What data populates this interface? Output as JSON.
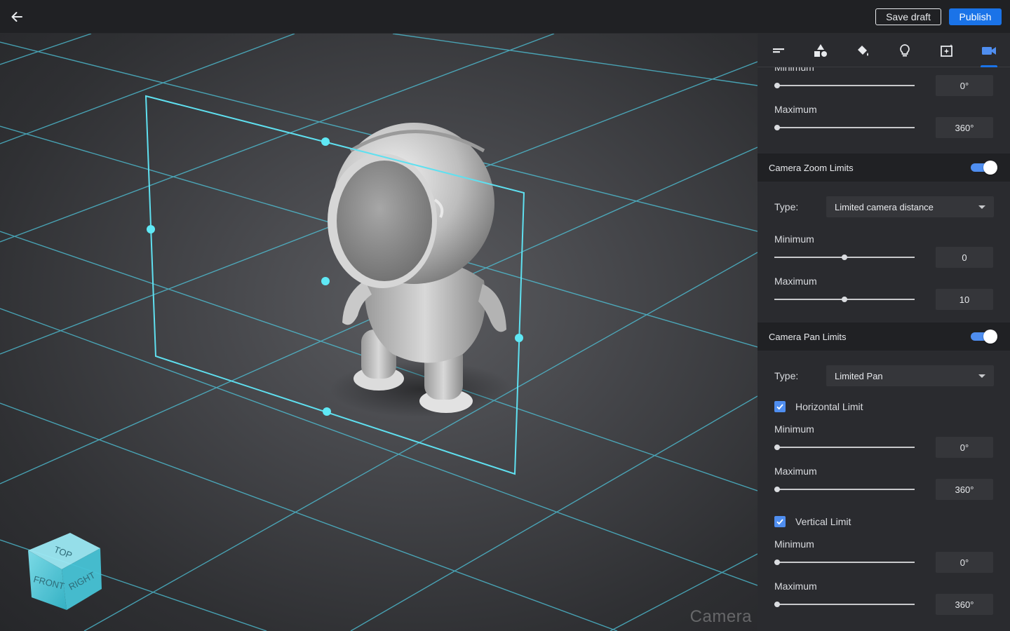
{
  "topbar": {
    "back_icon": "arrow-left-icon",
    "save_draft_label": "Save draft",
    "publish_label": "Publish",
    "accent_color": "#1a73e8"
  },
  "viewport": {
    "watermark": "Camera",
    "view_cube": {
      "top_label": "TOP",
      "front_label": "FRONT",
      "right_label": "RIGHT"
    }
  },
  "panel": {
    "tabs": [
      {
        "icon": "menu-lines-icon"
      },
      {
        "icon": "shapes-icon"
      },
      {
        "icon": "paint-bucket-icon"
      },
      {
        "icon": "lightbulb-icon"
      },
      {
        "icon": "image-sparkle-icon"
      },
      {
        "icon": "video-camera-icon",
        "active": true
      }
    ],
    "orbit_partial": {
      "min_label": "Minimum",
      "min_value": "0°",
      "min_fraction": 0.0,
      "max_label": "Maximum",
      "max_value": "360°",
      "max_fraction": 0.0
    },
    "zoom": {
      "title": "Camera Zoom Limits",
      "enabled": true,
      "type_label": "Type:",
      "type_value": "Limited camera distance",
      "min_label": "Minimum",
      "min_value": "0",
      "min_fraction": 0.5,
      "max_label": "Maximum",
      "max_value": "10",
      "max_fraction": 0.5
    },
    "pan": {
      "title": "Camera Pan Limits",
      "enabled": true,
      "type_label": "Type:",
      "type_value": "Limited Pan",
      "horizontal": {
        "checked": true,
        "label": "Horizontal Limit",
        "min_label": "Minimum",
        "min_value": "0°",
        "min_fraction": 0.0,
        "max_label": "Maximum",
        "max_value": "360°",
        "max_fraction": 0.0
      },
      "vertical": {
        "checked": true,
        "label": "Vertical Limit",
        "min_label": "Minimum",
        "min_value": "0°",
        "min_fraction": 0.0,
        "max_label": "Maximum",
        "max_value": "360°",
        "max_fraction": 0.0
      }
    }
  }
}
